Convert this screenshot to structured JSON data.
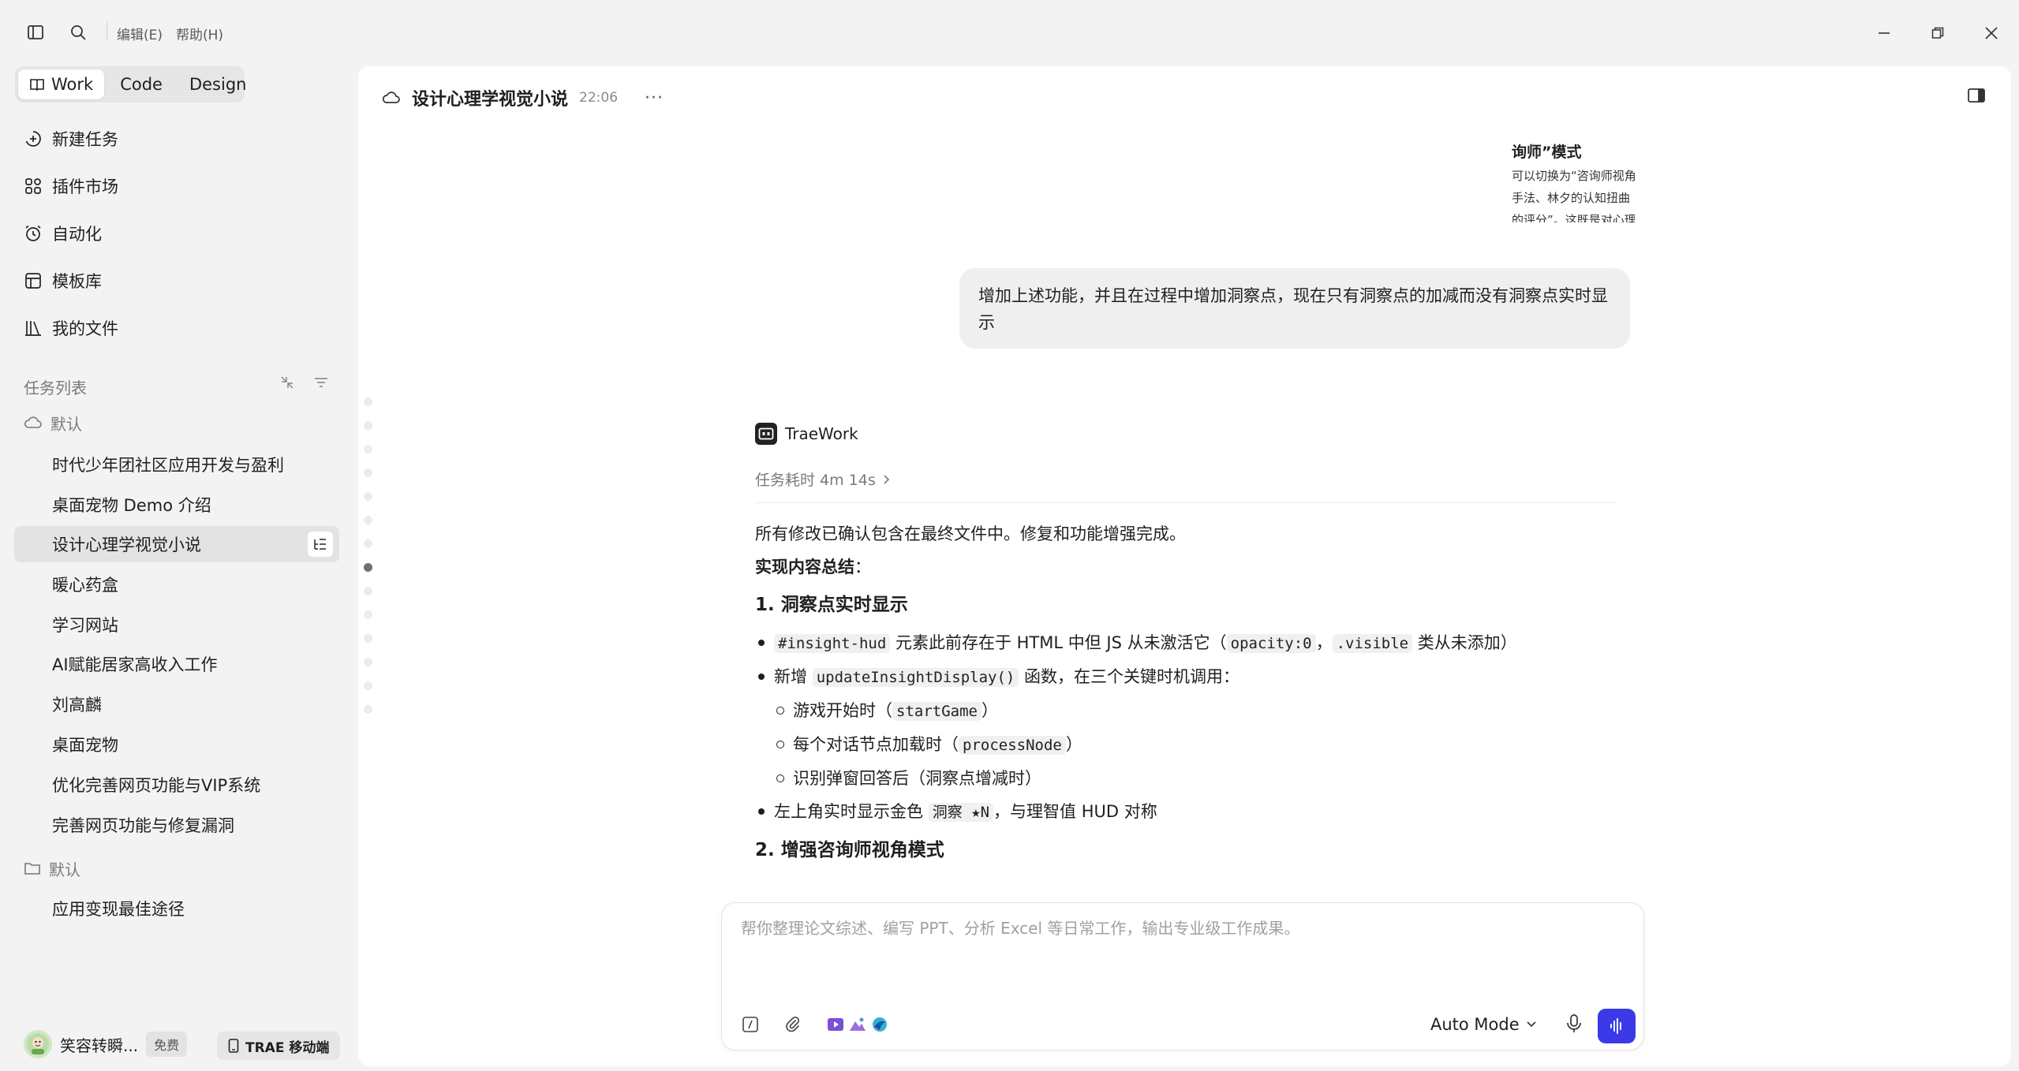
{
  "menu": {
    "edit": "编辑(E)",
    "help": "帮助(H)"
  },
  "modes": [
    "Work",
    "Code",
    "Design"
  ],
  "nav": {
    "new_task": "新建任务",
    "plugins": "插件市场",
    "automation": "自动化",
    "templates": "模板库",
    "my_files": "我的文件"
  },
  "task_list": {
    "label": "任务列表",
    "group1": "默认",
    "group1_items": [
      "时代少年团社区应用开发与盈利",
      "桌面宠物 Demo 介绍",
      "设计心理学视觉小说",
      "暖心药盒",
      "学习网站",
      "AI赋能居家高收入工作",
      "刘高麟",
      "桌面宠物",
      "优化完善网页功能与VIP系统",
      "完善网页功能与修复漏洞"
    ],
    "active_index": 2,
    "group2": "默认",
    "group2_items": [
      "应用变现最佳途径"
    ]
  },
  "user": {
    "name": "笑容转瞬...",
    "plan": "免费",
    "mobile_button": "TRAE 移动端"
  },
  "conversation": {
    "title": "设计心理学视觉小说",
    "time": "22:06",
    "more": "···",
    "clipped_heading": "询师”模式",
    "clipped_lines": [
      "可以切换为“咨询师视角",
      "手法、林夕的认知扭曲",
      "的评分”。这既是对心理"
    ],
    "user_message": "增加上述功能，并且在过程中增加洞察点，现在只有洞察点的加减而没有洞察点实时显示",
    "agent_name": "TraeWork",
    "duration": "任务耗时 4m 14s",
    "intro": "所有修改已确认包含在最终文件中。修复和功能增强完成。",
    "summary_label": "实现内容总结",
    "summary_colon": "：",
    "h1": "1. 洞察点实时显示",
    "b1_code1": "#insight-hud",
    "b1_text1": " 元素此前存在于 HTML 中但 JS 从未激活它（",
    "b1_code2": "opacity:0",
    "b1_text2": "，",
    "b1_code3": ".visible",
    "b1_text3": " 类从未添加）",
    "b2_text1": "新增 ",
    "b2_code1": "updateInsightDisplay()",
    "b2_text2": " 函数，在三个关键时机调用：",
    "s1_text1": "游戏开始时（",
    "s1_code": "startGame",
    "s1_text2": "）",
    "s2_text1": "每个对话节点加载时（",
    "s2_code": "processNode",
    "s2_text2": "）",
    "s3_text": "识别弹窗回答后（洞察点增减时）",
    "b3_text1": "左上角实时显示金色 ",
    "b3_code": "洞察 ★N",
    "b3_text2": "，与理智值 HUD 对称",
    "h2": "2. 增强咨询师视角模式"
  },
  "composer": {
    "placeholder": "帮你整理论文综述、编写 PPT、分析 Excel 等日常工作，输出专业级工作成果。",
    "mode": "Auto Mode"
  },
  "colors": {
    "send_button": "#3a3ae8",
    "main_bg": "#ffffff",
    "sidebar_bg": "#f3f3f3"
  },
  "icons": [
    "sidebar-toggle-icon",
    "search-icon",
    "minimize-icon",
    "restore-icon",
    "close-icon",
    "book-icon",
    "plus-circle-icon",
    "grid-icon",
    "alarm-icon",
    "template-icon",
    "files-icon",
    "collapse-icon",
    "filter-icon",
    "cloud-icon",
    "folder-icon",
    "outline-icon",
    "phone-icon",
    "panel-icon",
    "chevron-right-icon",
    "chevron-down-icon",
    "slash-command-icon",
    "paperclip-icon",
    "mic-icon",
    "voice-wave-icon"
  ]
}
